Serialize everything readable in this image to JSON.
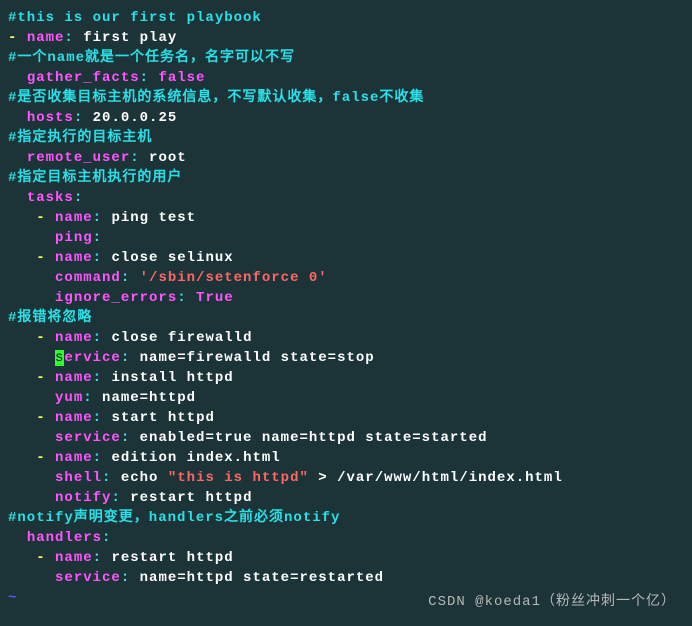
{
  "c1": "#this is our first playbook",
  "k_name": "name",
  "v_first_play": "first play",
  "c2": "#一个name就是一个任务名，名字可以不写",
  "k_gather": "gather_facts",
  "v_false": "false",
  "c3": "#是否收集目标主机的系统信息，不写默认收集，false不收集",
  "k_hosts": "hosts",
  "v_hosts": "20.0.0.25",
  "c4": "#指定执行的目标主机",
  "k_remote": "remote_user",
  "v_root": "root",
  "c5": "#指定目标主机执行的用户",
  "k_tasks": "tasks",
  "v_ping_test": "ping test",
  "k_ping": "ping",
  "v_close_selinux": "close selinux",
  "k_command": "command",
  "v_setenforce": "'/sbin/setenforce 0'",
  "k_ignore": "ignore_errors",
  "v_true": "True",
  "c6": "#报错将忽略",
  "v_close_fw": "close firewalld",
  "cursor_s": "s",
  "k_ervice": "ervice",
  "v_fw_args": "name=firewalld state=stop",
  "v_install_httpd": "install httpd",
  "k_yum": "yum",
  "v_yum_args": "name=httpd",
  "v_start_httpd": "start httpd",
  "k_service": "service",
  "v_start_args": "enabled=true name=httpd state=started",
  "v_edition": "edition index.html",
  "k_shell": "shell",
  "v_echo": "echo ",
  "v_echo_str": "\"this is httpd\"",
  "v_echo_redir": " > /var/www/html/index.html",
  "k_notify": "notify",
  "v_restart_httpd": "restart httpd",
  "c7": "#notify声明变更，handlers之前必须notify",
  "k_handlers": "handlers",
  "v_handler_args": "name=httpd state=restarted",
  "tilde": "~",
  "watermark": "CSDN @koeda1（粉丝冲刺一个亿）"
}
